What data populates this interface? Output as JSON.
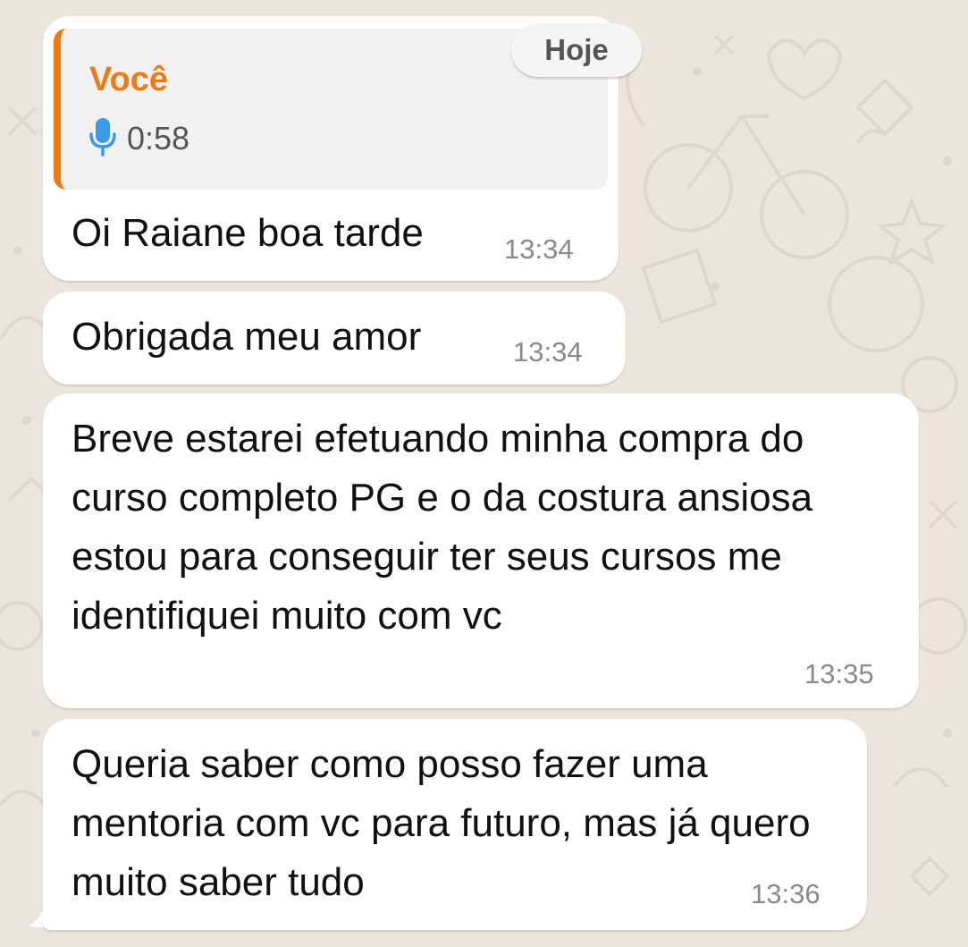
{
  "date_badge": "Hoje",
  "quoted_message": {
    "author": "Você",
    "mic_icon": "microphone-icon",
    "duration": "0:58"
  },
  "messages": [
    {
      "text": "Oi Raiane boa tarde",
      "time": "13:34"
    },
    {
      "text": "Obrigada meu amor",
      "time": "13:34"
    },
    {
      "text": "Breve estarei efetuando minha compra do curso completo PG e o da costura ansiosa estou para conseguir ter seus cursos me identifiquei muito com vc",
      "time": "13:35"
    },
    {
      "text": "Queria saber como posso fazer uma mentoria com vc para futuro, mas já quero muito saber tudo",
      "time": "13:36"
    }
  ],
  "colors": {
    "background": "#ECE5DD",
    "bubble": "#FFFFFF",
    "quote_accent": "#EE7A11",
    "mic": "#3A9BE8",
    "timestamp": "#8A8A8A"
  }
}
